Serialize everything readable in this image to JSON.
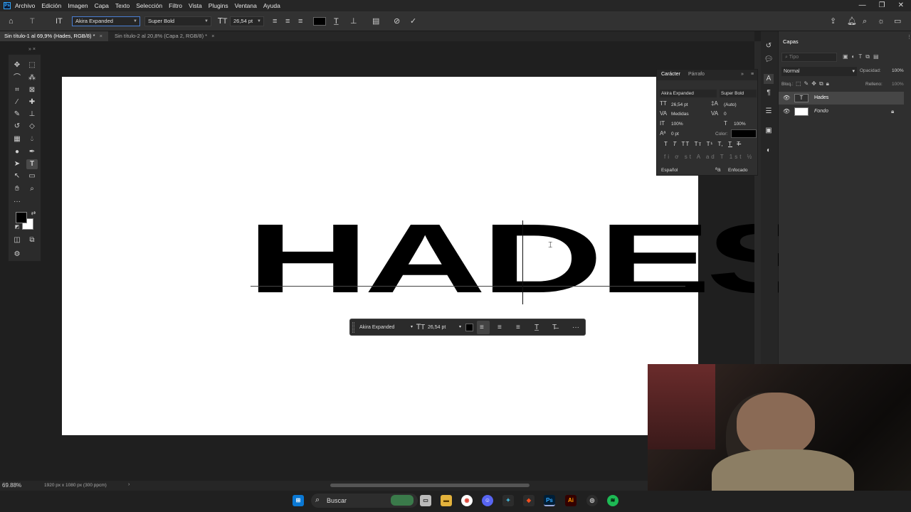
{
  "menu": [
    "Archivo",
    "Edición",
    "Imagen",
    "Capa",
    "Texto",
    "Selección",
    "Filtro",
    "Vista",
    "Plugins",
    "Ventana",
    "Ayuda"
  ],
  "app_logo": "Ps",
  "options": {
    "font_family": "Akira Expanded",
    "font_style": "Super Bold",
    "font_size": "26,54 pt",
    "text_color": "#000000"
  },
  "tabs": [
    {
      "label": "Sin título-1 al 69,9% (Hades, RGB/8) *",
      "active": true
    },
    {
      "label": "Sin título-2 al 20,8% (Capa 2, RGB/8) *",
      "active": false
    }
  ],
  "canvas": {
    "text": "HADES"
  },
  "context_bar": {
    "font_family": "Akira Expanded",
    "font_size": "26,54 pt",
    "more": "···"
  },
  "character_panel": {
    "tab_character": "Carácter",
    "tab_paragraph": "Párrafo",
    "font_family": "Akira Expanded",
    "font_style": "Super Bold",
    "size": "26,54 pt",
    "leading": "(Auto)",
    "kerning": "Medidas",
    "tracking": "0",
    "vertical_scale": "100%",
    "horizontal_scale": "100%",
    "baseline_shift": "0 pt",
    "color_label": "Color:",
    "color": "#000000",
    "language": "Español",
    "antialias": "Enfocado",
    "style_buttons": [
      "T",
      "T",
      "TT",
      "Tт",
      "T¹",
      "T,",
      "T",
      "T"
    ]
  },
  "layers_panel": {
    "title": "Capas",
    "search_placeholder": "Tipo",
    "blend_mode": "Normal",
    "opacity_label": "Opacidad:",
    "opacity": "100%",
    "lock_label": "Bloq.:",
    "fill_label": "Relleno:",
    "fill": "100%",
    "layers": [
      {
        "name": "Hades",
        "kind": "text",
        "selected": true
      },
      {
        "name": "Fondo",
        "kind": "pixel",
        "locked": true
      }
    ]
  },
  "status": {
    "zoom": "69.88%",
    "doc_info": "1920 px x 1080 px (300 ppcm)"
  },
  "taskbar": {
    "search_label": "Buscar"
  }
}
